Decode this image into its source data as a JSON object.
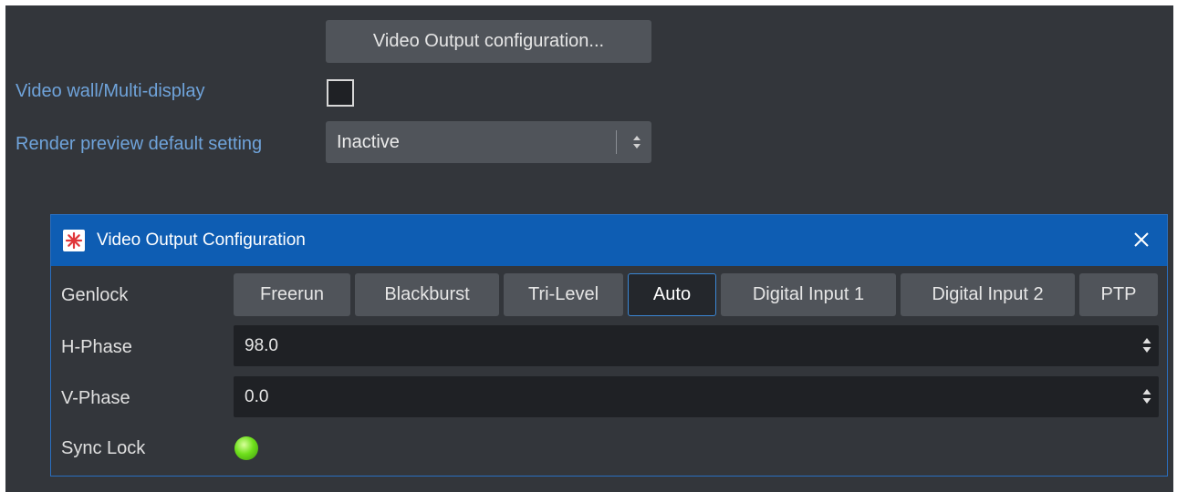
{
  "settings": {
    "video_output_button": "Video Output configuration...",
    "video_wall_label": "Video wall/Multi-display",
    "video_wall_checked": false,
    "render_preview_label": "Render preview default setting",
    "render_preview_value": "Inactive"
  },
  "dialog": {
    "title": "Video Output Configuration",
    "genlock_label": "Genlock",
    "genlock_options": [
      "Freerun",
      "Blackburst",
      "Tri-Level",
      "Auto",
      "Digital Input 1",
      "Digital Input 2",
      "PTP"
    ],
    "genlock_selected": "Auto",
    "h_phase_label": "H-Phase",
    "h_phase_value": "98.0",
    "v_phase_label": "V-Phase",
    "v_phase_value": "0.0",
    "sync_lock_label": "Sync Lock",
    "sync_lock_status": "locked"
  },
  "colors": {
    "panel_bg": "#33363b",
    "label_blue": "#6fa3da",
    "titlebar_blue": "#0e5db3",
    "sync_led": "#6fe01c"
  },
  "icons": {
    "app": "asterisk-app-icon",
    "close": "close-icon",
    "spin": "up-down-arrows-icon"
  }
}
